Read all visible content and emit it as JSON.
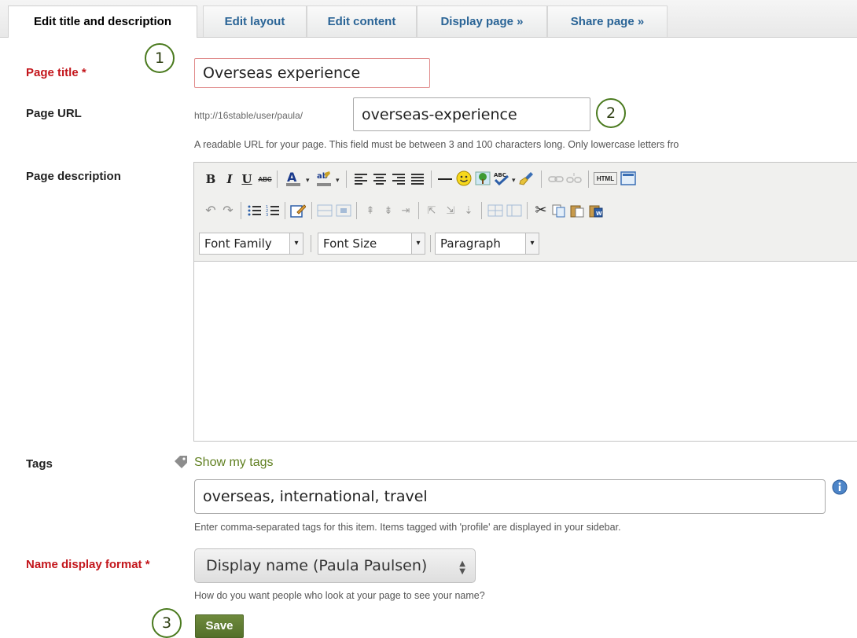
{
  "tabs": [
    {
      "label": "Edit title and description"
    },
    {
      "label": "Edit layout"
    },
    {
      "label": "Edit content"
    },
    {
      "label": "Display page »"
    },
    {
      "label": "Share page »"
    }
  ],
  "form": {
    "title_label": "Page title *",
    "title_value": "Overseas experience",
    "url_label": "Page URL",
    "url_prefix": "http://16stable/user/paula/",
    "url_value": "overseas-experience",
    "url_help": "A readable URL for your page. This field must be between 3 and 100 characters long. Only lowercase letters fro",
    "description_label": "Page description",
    "tags_label": "Tags",
    "show_my_tags": "Show my tags",
    "tags_value": "overseas, international, travel",
    "tags_help": "Enter comma-separated tags for this item. Items tagged with 'profile' are displayed in your sidebar.",
    "name_format_label": "Name display format *",
    "name_format_value": "Display name (Paula Paulsen)",
    "name_format_help": "How do you want people who look at your page to see your name?",
    "save_label": "Save"
  },
  "editor": {
    "font_family": "Font Family",
    "font_size": "Font Size",
    "format": "Paragraph",
    "btn_bold": "B",
    "btn_italic": "I",
    "btn_underline": "U",
    "btn_strike": "ABC",
    "btn_html": "HTML",
    "btn_spell": "ABC"
  },
  "callouts": {
    "one": "1",
    "two": "2",
    "three": "3"
  },
  "colors": {
    "required": "#c3161c",
    "link": "#2a6496",
    "accent": "#4a7a1e",
    "save": "#5f7b33"
  },
  "icons": [
    "tag-icon",
    "info-icon",
    "smiley-icon",
    "image-icon",
    "cut-icon",
    "copy-icon",
    "paste-icon"
  ]
}
